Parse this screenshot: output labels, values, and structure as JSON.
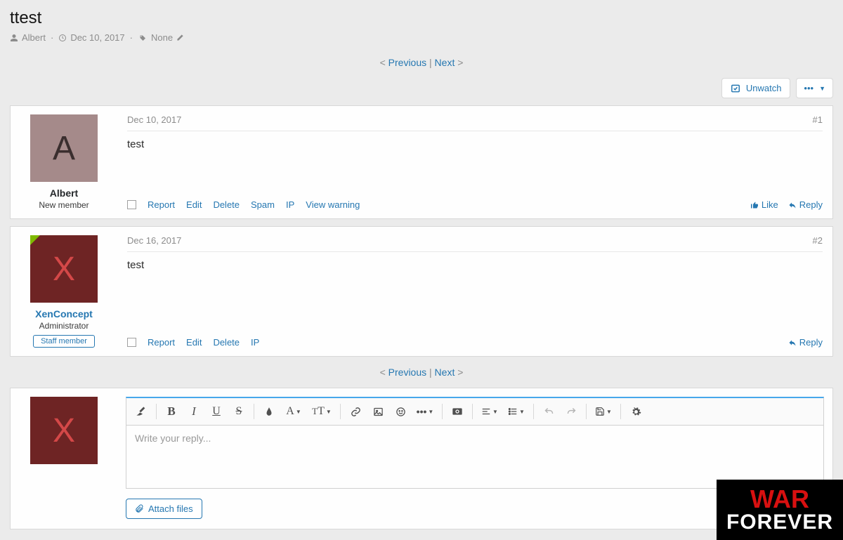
{
  "thread": {
    "title": "ttest",
    "author": "Albert",
    "date": "Dec 10, 2017",
    "tags": "None"
  },
  "nav": {
    "previous": "Previous",
    "next": "Next"
  },
  "actions": {
    "unwatch": "Unwatch"
  },
  "posts": [
    {
      "date": "Dec 10, 2017",
      "number": "#1",
      "user": {
        "name": "Albert",
        "initial": "A",
        "title": "New member"
      },
      "content": "test",
      "mod": {
        "report": "Report",
        "edit": "Edit",
        "delete": "Delete",
        "spam": "Spam",
        "ip": "IP",
        "view_warning": "View warning"
      },
      "react": {
        "like": "Like",
        "reply": "Reply"
      }
    },
    {
      "date": "Dec 16, 2017",
      "number": "#2",
      "user": {
        "name": "XenConcept",
        "initial": "X",
        "title": "Administrator",
        "banner": "Staff member"
      },
      "content": "test",
      "mod": {
        "report": "Report",
        "edit": "Edit",
        "delete": "Delete",
        "ip": "IP"
      },
      "react": {
        "reply": "Reply"
      }
    }
  ],
  "editor": {
    "current_user_initial": "X",
    "placeholder": "Write your reply...",
    "attach": "Attach files"
  },
  "watermark": {
    "line1": "WAR",
    "line2": "FOREVER"
  }
}
